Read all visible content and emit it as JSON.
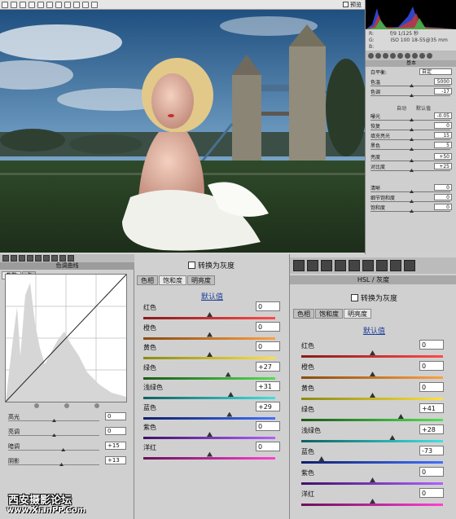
{
  "toolbar": {
    "preview_label": "预览"
  },
  "readout": {
    "line1": "f/9  1/125 秒",
    "line2": "ISO 100  18-55@35 mm",
    "r": "R:",
    "g": "G:",
    "b": "B:"
  },
  "basic": {
    "title": "基本",
    "white_balance_label": "白平衡:",
    "white_balance_value": "自定",
    "rows": [
      {
        "label": "色温",
        "value": "5000"
      },
      {
        "label": "色调",
        "value": "-17"
      },
      {
        "label": "曝光",
        "value": "-0.05"
      },
      {
        "label": "恢复",
        "value": "0"
      },
      {
        "label": "填充亮光",
        "value": "15"
      },
      {
        "label": "黑色",
        "value": "5"
      },
      {
        "label": "亮度",
        "value": "+50"
      },
      {
        "label": "对比度",
        "value": "+25"
      },
      {
        "label": "清晰",
        "value": "0"
      },
      {
        "label": "细节饱和度",
        "value": "0"
      },
      {
        "label": "饱和度",
        "value": "0"
      }
    ],
    "auto_label": "自动",
    "default_label": "默认值"
  },
  "curve_panel": {
    "title": "色调曲线",
    "tabs": [
      "参数",
      "点"
    ],
    "sliders": [
      {
        "label": "高光",
        "value": "0",
        "pos": 0.5
      },
      {
        "label": "亮调",
        "value": "0",
        "pos": 0.5
      },
      {
        "label": "暗调",
        "value": "+15",
        "pos": 0.6
      },
      {
        "label": "阴影",
        "value": "+13",
        "pos": 0.58
      }
    ]
  },
  "hsl_mid": {
    "convert_label": "转换为灰度",
    "tabs": [
      "色相",
      "饱和度",
      "明亮度"
    ],
    "active_tab": 1,
    "default_label": "默认值",
    "rows": [
      {
        "label": "红色",
        "value": "0",
        "pos": 0.5
      },
      {
        "label": "橙色",
        "value": "0",
        "pos": 0.5
      },
      {
        "label": "黄色",
        "value": "0",
        "pos": 0.5
      },
      {
        "label": "绿色",
        "value": "+27",
        "pos": 0.64
      },
      {
        "label": "浅绿色",
        "value": "+31",
        "pos": 0.66
      },
      {
        "label": "蓝色",
        "value": "+29",
        "pos": 0.65
      },
      {
        "label": "紫色",
        "value": "0",
        "pos": 0.5
      },
      {
        "label": "洋红",
        "value": "0",
        "pos": 0.5
      }
    ]
  },
  "hsl_right": {
    "title": "HSL / 灰度",
    "convert_label": "转换为灰度",
    "tabs": [
      "色相",
      "饱和度",
      "明亮度"
    ],
    "active_tab": 2,
    "default_label": "默认值",
    "rows": [
      {
        "label": "红色",
        "value": "0",
        "pos": 0.5
      },
      {
        "label": "橙色",
        "value": "0",
        "pos": 0.5
      },
      {
        "label": "黄色",
        "value": "0",
        "pos": 0.5
      },
      {
        "label": "绿色",
        "value": "+41",
        "pos": 0.7
      },
      {
        "label": "浅绿色",
        "value": "+28",
        "pos": 0.64
      },
      {
        "label": "蓝色",
        "value": "-73",
        "pos": 0.14
      },
      {
        "label": "紫色",
        "value": "0",
        "pos": 0.5
      },
      {
        "label": "洋红",
        "value": "0",
        "pos": 0.5
      }
    ]
  },
  "watermark": {
    "line1": "西安摄影论坛",
    "line2": "www.XianPP.Com"
  }
}
